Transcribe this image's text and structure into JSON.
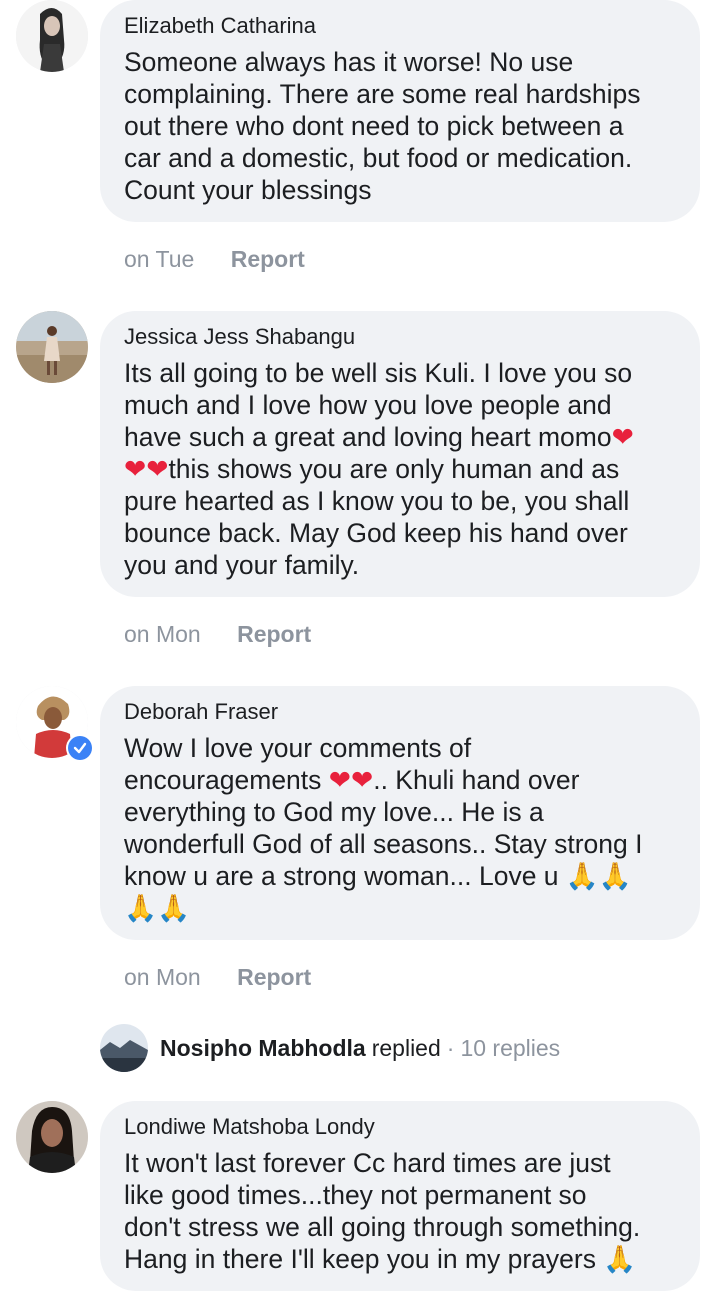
{
  "comments": [
    {
      "author": "Elizabeth Catharina",
      "text_lines": [
        "Someone always has it worse! No use",
        "complaining. There are some real hardships",
        "out there who dont need to pick between a",
        "car and a domestic, but food or medication.",
        "Count your blessings"
      ],
      "time": "on Tue",
      "report": "Report"
    },
    {
      "author": "Jessica Jess Shabangu",
      "text_lines": [
        "Its all going to be well sis Kuli. I love you so",
        "much and I love how you love people and",
        "have such a great and loving heart momo",
        "this shows you are only human and as",
        "pure hearted as I know you to be, you shall",
        "bounce back. May God keep his hand over",
        "you and your family."
      ],
      "time": "on Mon",
      "report": "Report"
    },
    {
      "author": "Deborah Fraser",
      "text_lines": [
        "Wow I love your comments of",
        "encouragements ",
        ".. Khuli hand over",
        "everything to God my love... He is a",
        "wonderfull God of all seasons.. Stay strong I",
        "know u are a strong woman... Love u "
      ],
      "time": "on Mon",
      "report": "Report"
    },
    {
      "author": "Londiwe Matshoba Londy",
      "text_lines": [
        "It won't last forever Cc hard times are just",
        "like good times...they not permanent so",
        "don't stress we all going through something.",
        "Hang in there I'll keep you in my prayers "
      ]
    }
  ],
  "replies_summary": {
    "name": "Nosipho Mabhodla",
    "verb": "replied",
    "separator": "·",
    "count": "10 replies"
  },
  "emoji": {
    "heart": "❤",
    "pray": "🙏"
  },
  "colors": {
    "bubble": "#f0f2f5",
    "meta_text": "#8d949e",
    "verified_badge": "#3b82f6",
    "heart": "#e8213c"
  }
}
